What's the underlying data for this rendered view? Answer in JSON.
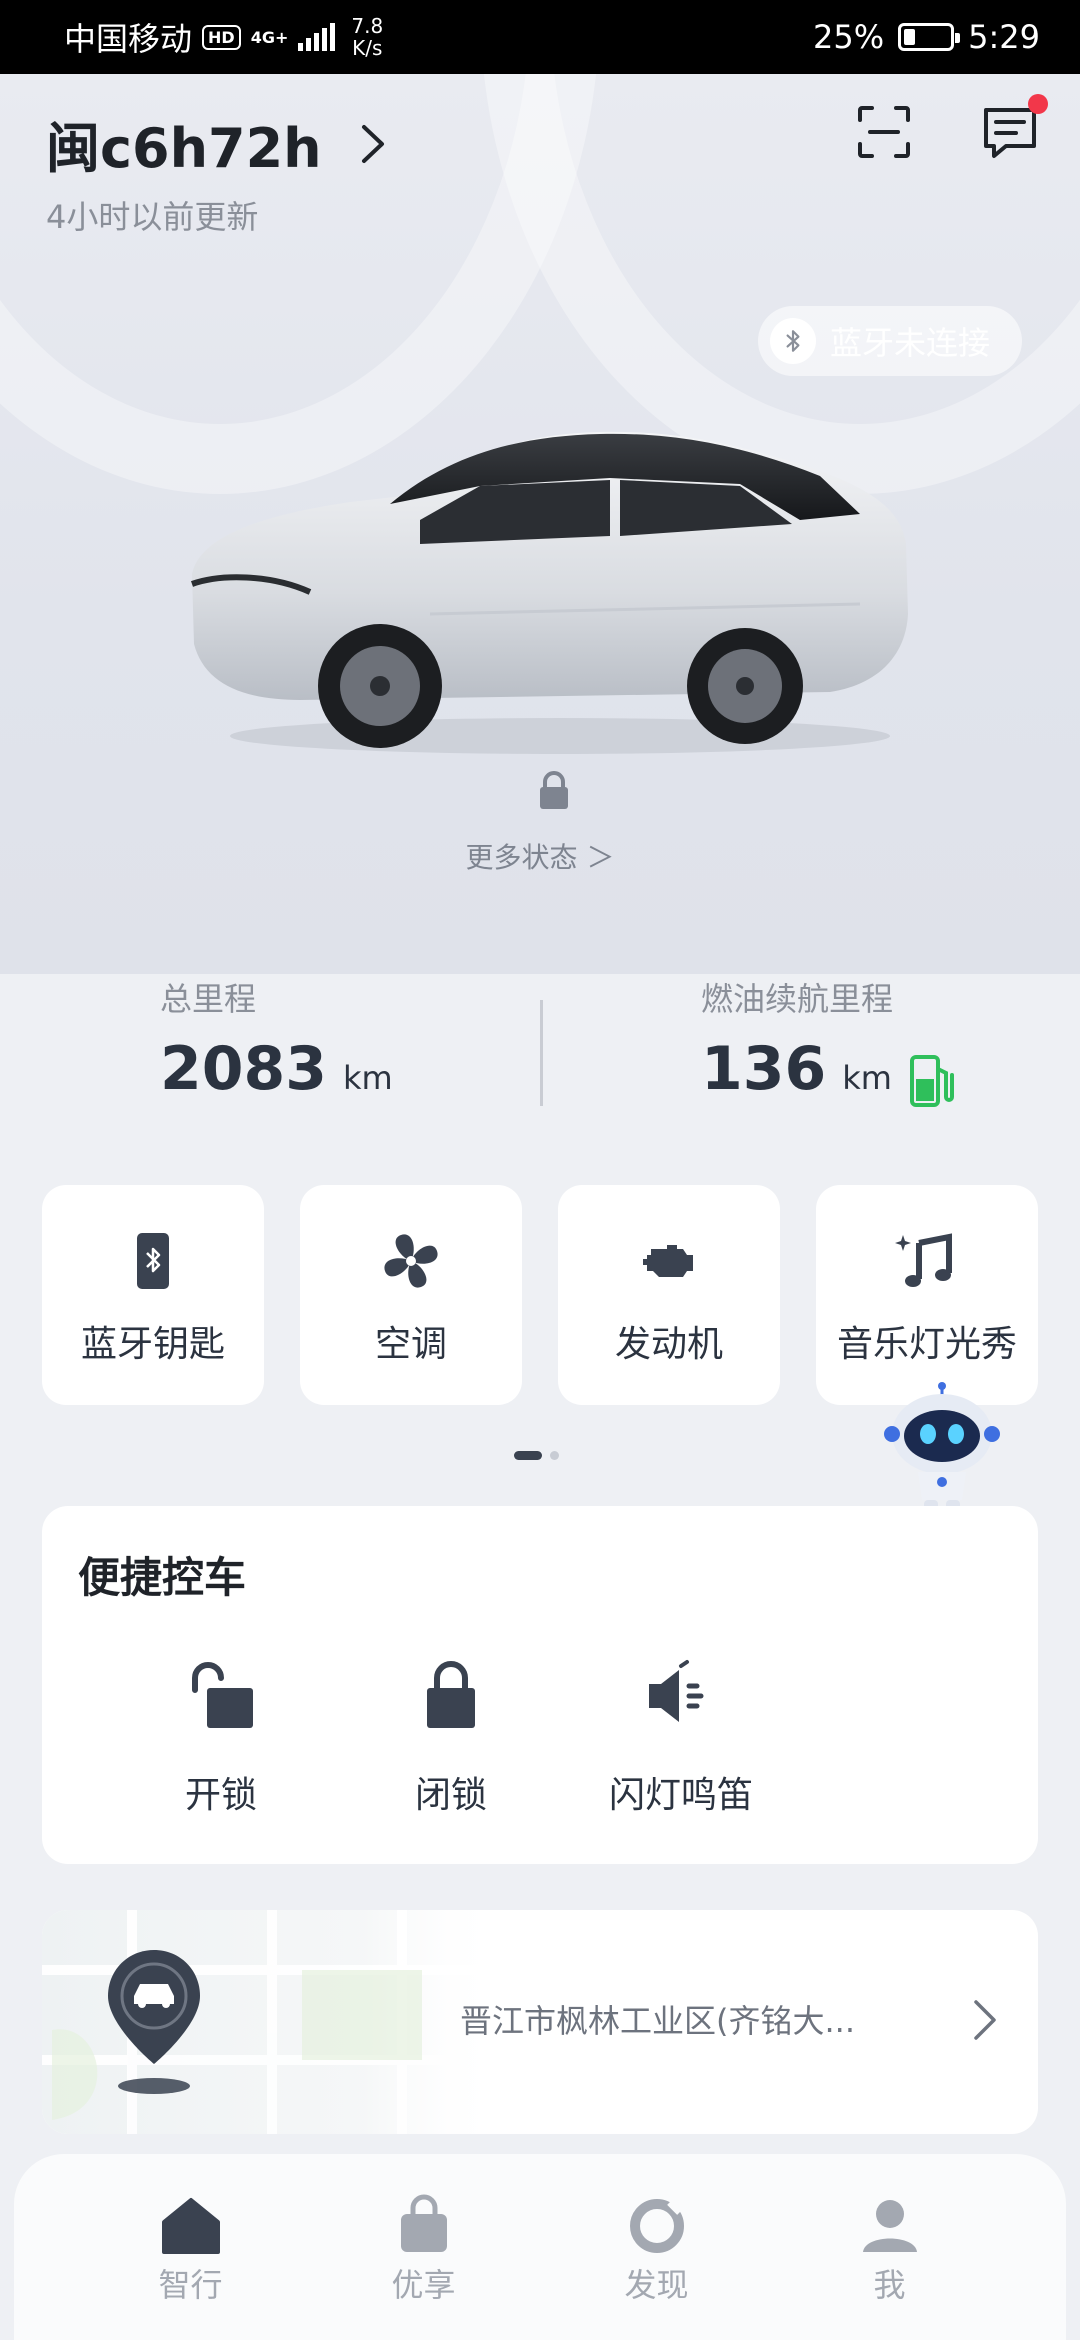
{
  "status_bar": {
    "carrier": "中国移动",
    "hd": "HD",
    "network": "4G+",
    "speed_value": "7.8",
    "speed_unit": "K/s",
    "battery_percent": "25%",
    "battery_level": 0.25,
    "time": "5:29"
  },
  "header": {
    "plate": "闽c6h72h",
    "updated": "4小时以前更新",
    "notification_dot_color": "#f2374a"
  },
  "bluetooth_status": "蓝牙未连接",
  "more_status": "更多状态 ＞",
  "stats": {
    "total_mileage_label": "总里程",
    "total_mileage_value": "2083",
    "total_mileage_unit": "km",
    "fuel_range_label": "燃油续航里程",
    "fuel_range_value": "136",
    "fuel_range_unit": "km"
  },
  "quick_cards": [
    {
      "label": "蓝牙钥匙",
      "icon": "bluetooth-key-icon"
    },
    {
      "label": "空调",
      "icon": "fan-icon"
    },
    {
      "label": "发动机",
      "icon": "engine-icon"
    },
    {
      "label": "音乐灯光秀",
      "icon": "music-icon"
    }
  ],
  "quick_control": {
    "title": "便捷控车",
    "items": [
      {
        "label": "开锁",
        "icon": "unlock-icon"
      },
      {
        "label": "闭锁",
        "icon": "lock-icon"
      },
      {
        "label": "闪灯鸣笛",
        "icon": "horn-icon"
      }
    ]
  },
  "location": {
    "address": "晋江市枫林工业区(齐铭大..."
  },
  "tabbar": {
    "items": [
      {
        "label": "智行",
        "icon": "home-icon",
        "active": true
      },
      {
        "label": "优享",
        "icon": "bag-icon"
      },
      {
        "label": "发现",
        "icon": "discover-icon"
      },
      {
        "label": "我",
        "icon": "profile-icon"
      }
    ]
  },
  "colors": {
    "accent_dark": "#3a4250",
    "fuel_green": "#2fbf5b",
    "background": "#eef0f4"
  }
}
